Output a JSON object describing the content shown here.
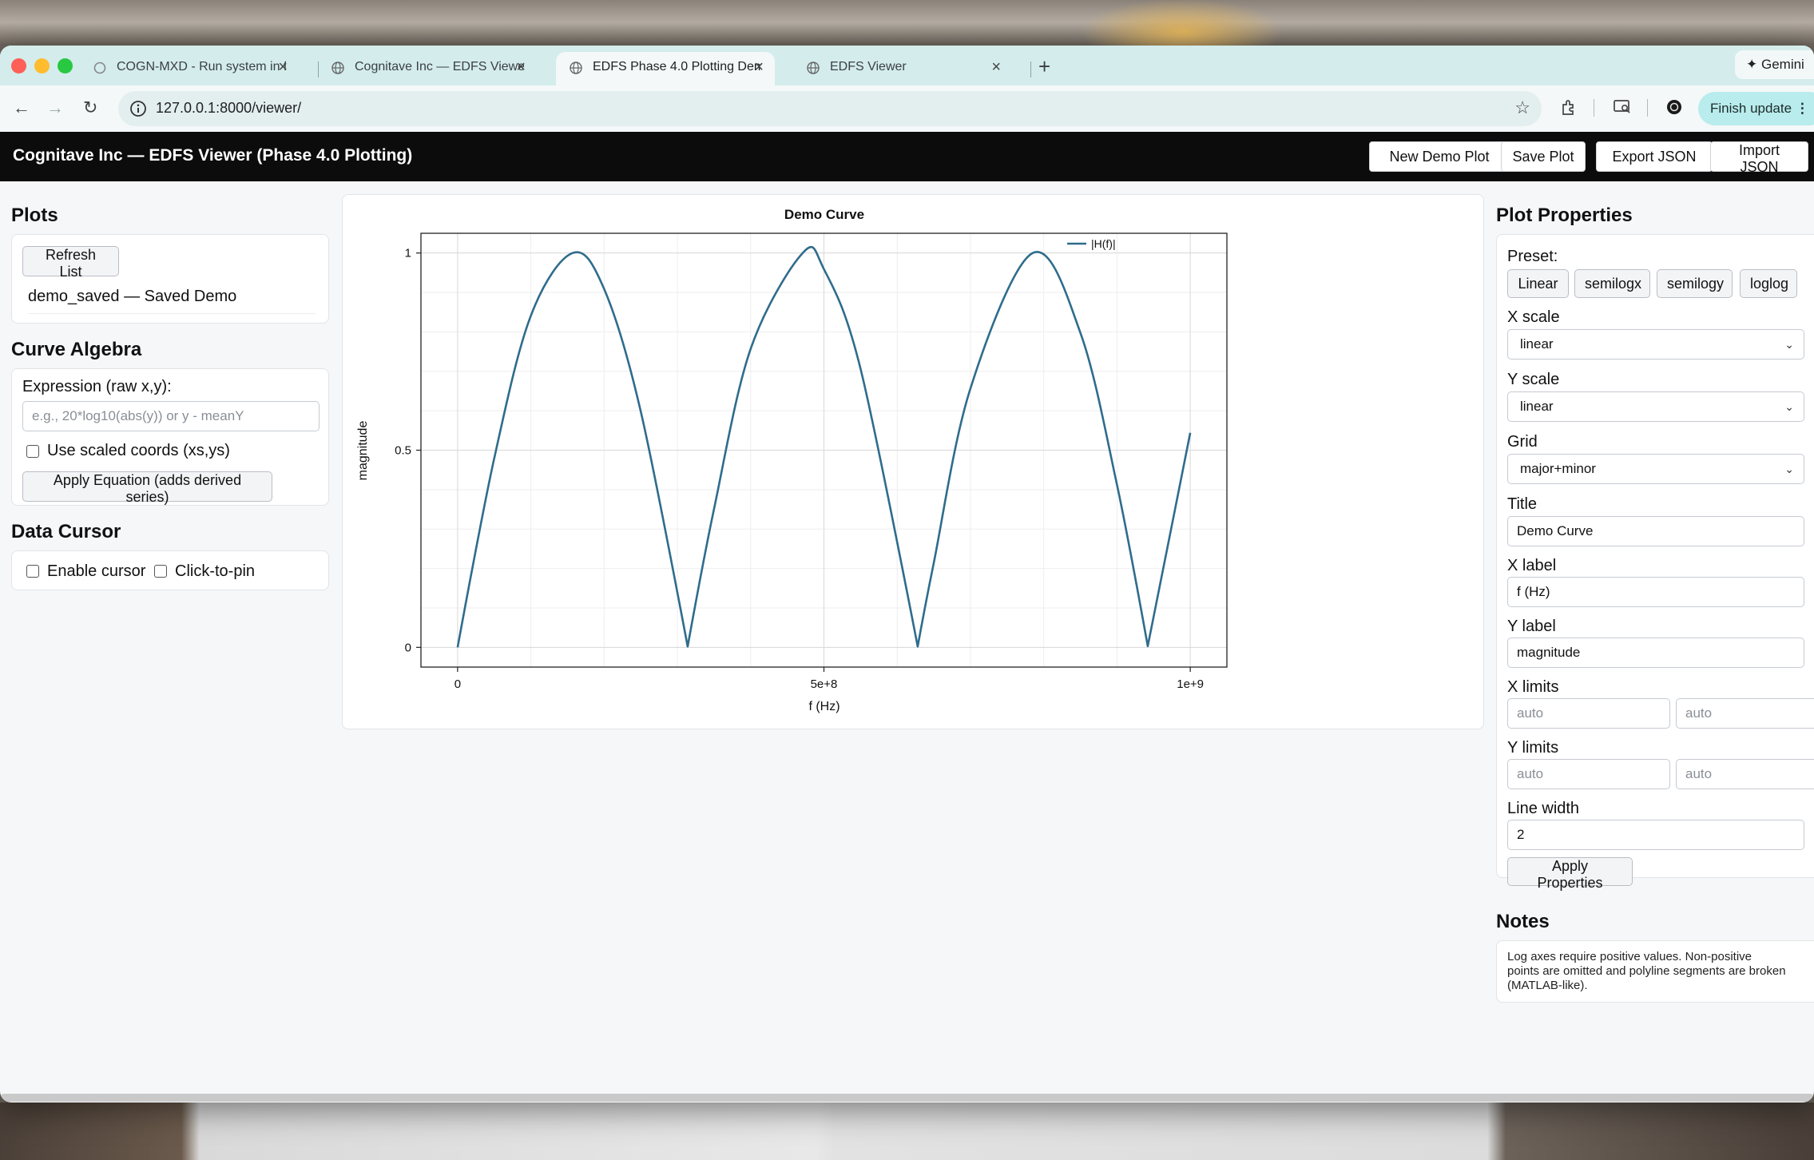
{
  "browser": {
    "tabs": [
      {
        "title": "COGN-MXD - Run system in f",
        "active": false
      },
      {
        "title": "Cognitave Inc — EDFS Viewer",
        "active": false
      },
      {
        "title": "EDFS Phase 4.0 Plotting Dem",
        "active": true
      },
      {
        "title": "EDFS Viewer",
        "active": false
      }
    ],
    "gemini_label": "Gemini",
    "url": "127.0.0.1:8000/viewer/",
    "finish_update_label": "Finish update"
  },
  "app": {
    "title": "Cognitave Inc — EDFS Viewer (Phase 4.0 Plotting)",
    "buttons": {
      "new_demo": "New Demo Plot",
      "save_plot": "Save Plot",
      "export_json": "Export JSON",
      "import_json": "Import JSON"
    }
  },
  "plots_panel": {
    "heading": "Plots",
    "refresh_label": "Refresh List",
    "items": [
      "demo_saved — Saved Demo"
    ]
  },
  "curve_algebra": {
    "heading": "Curve Algebra",
    "expression_label": "Expression (raw x,y):",
    "expression_placeholder": "e.g., 20*log10(abs(y)) or y - meanY",
    "expression_value": "",
    "scaled_label": "Use scaled coords (xs,ys)",
    "scaled_checked": false,
    "apply_label": "Apply Equation (adds derived series)"
  },
  "data_cursor": {
    "heading": "Data Cursor",
    "enable_label": "Enable cursor",
    "enable_checked": false,
    "pin_label": "Click-to-pin",
    "pin_checked": false
  },
  "chart_data": {
    "type": "line",
    "title": "Demo Curve",
    "xlabel": "f (Hz)",
    "ylabel": "magnitude",
    "xlim": [
      -50000000,
      1050000000
    ],
    "ylim": [
      -0.05,
      1.05
    ],
    "x_ticks": [
      {
        "value": 0,
        "label": "0"
      },
      {
        "value": 500000000,
        "label": "5e+8"
      },
      {
        "value": 1000000000,
        "label": "1e+9"
      }
    ],
    "y_ticks": [
      {
        "value": 0,
        "label": "0"
      },
      {
        "value": 0.5,
        "label": "0.5"
      },
      {
        "value": 1,
        "label": "1"
      }
    ],
    "grid": "major+minor",
    "legend_position": "top-right",
    "series": [
      {
        "name": "|H(f)|",
        "color": "#2f6c8c",
        "x": [
          0,
          50000000,
          100000000,
          157000000,
          200000000,
          250000000,
          314000000,
          350000000,
          400000000,
          471000000,
          500000000,
          550000000,
          628000000,
          650000000,
          700000000,
          785000000,
          850000000,
          900000000,
          942000000,
          1000000000
        ],
        "y": [
          0.0,
          0.479,
          0.841,
          1.0,
          0.909,
          0.598,
          0.002,
          0.351,
          0.757,
          1.0,
          0.959,
          0.706,
          0.002,
          0.215,
          0.657,
          1.0,
          0.798,
          0.412,
          0.003,
          0.544
        ]
      }
    ]
  },
  "plot_properties": {
    "heading": "Plot Properties",
    "preset_label": "Preset:",
    "presets": [
      "Linear",
      "semilogx",
      "semilogy",
      "loglog"
    ],
    "xscale_label": "X scale",
    "xscale_value": "linear",
    "yscale_label": "Y scale",
    "yscale_value": "linear",
    "grid_label": "Grid",
    "grid_value": "major+minor",
    "title_label": "Title",
    "title_value": "Demo Curve",
    "xlabel_label": "X label",
    "xlabel_value": "f (Hz)",
    "ylabel_label": "Y label",
    "ylabel_value": "magnitude",
    "xlimits_label": "X limits",
    "xlim_min_placeholder": "auto",
    "xlim_max_placeholder": "auto",
    "ylimits_label": "Y limits",
    "ylim_min_placeholder": "auto",
    "ylim_max_placeholder": "auto",
    "linewidth_label": "Line width",
    "linewidth_value": "2",
    "apply_label": "Apply Properties"
  },
  "notes": {
    "heading": "Notes",
    "lines": [
      "Log axes require positive values. Non-positive",
      "points are omitted and polyline segments are broken",
      "(MATLAB-like)."
    ]
  }
}
